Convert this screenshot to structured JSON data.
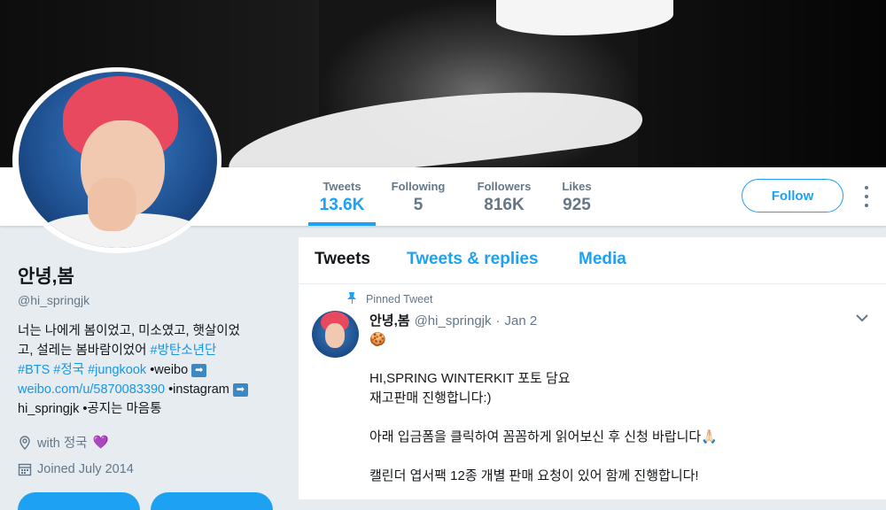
{
  "stats": [
    {
      "label": "Tweets",
      "value": "13.6K"
    },
    {
      "label": "Following",
      "value": "5"
    },
    {
      "label": "Followers",
      "value": "816K"
    },
    {
      "label": "Likes",
      "value": "925"
    }
  ],
  "follow_label": "Follow",
  "profile": {
    "name": "안녕,봄",
    "handle": "@hi_springjk",
    "bio_line1": "너는 나에게 봄이었고, 미소였고, 햇살이었",
    "bio_line2a": "고, 설레는 봄바람이었어 ",
    "bio_tag1": "#방탄소년단",
    "bio_tag2": "#BTS",
    "bio_tag3": "#정국",
    "bio_tag4": "#jungkook",
    "bio_weibo": " •weibo ",
    "bio_link": "weibo.com/u/5870083390",
    "bio_insta": " •instagram ",
    "bio_line_last": "hi_springjk •공지는 마음통",
    "arrow_glyph": "➡",
    "location": "with 정국",
    "location_heart": "💜",
    "joined": "Joined July 2014"
  },
  "tabs": [
    {
      "label": "Tweets"
    },
    {
      "label": "Tweets & replies"
    },
    {
      "label": "Media"
    }
  ],
  "tweet": {
    "pinned_label": "Pinned Tweet",
    "name": "안녕,봄",
    "handle": "@hi_springjk",
    "dot": "·",
    "date": "Jan 2",
    "cookie": "🍪",
    "line1": "HI,SPRING WINTERKIT 포토 담요",
    "line2": "재고판매 진행합니다:)",
    "line3": "아래 입금폼을 클릭하여 꼼꼼하게 읽어보신 후 신청 바랍니다🙏🏻",
    "line4": "캘린더 엽서팩 12종 개별 판매 요청이 있어 함께 진행합니다!"
  },
  "colors": {
    "accent": "#1da1f2",
    "link": "#1b95e0",
    "muted": "#657786",
    "page_bg": "#e6ecf0"
  },
  "icons": [
    "pin-icon",
    "chevron-down-icon",
    "location-icon",
    "calendar-icon",
    "more-icon"
  ]
}
